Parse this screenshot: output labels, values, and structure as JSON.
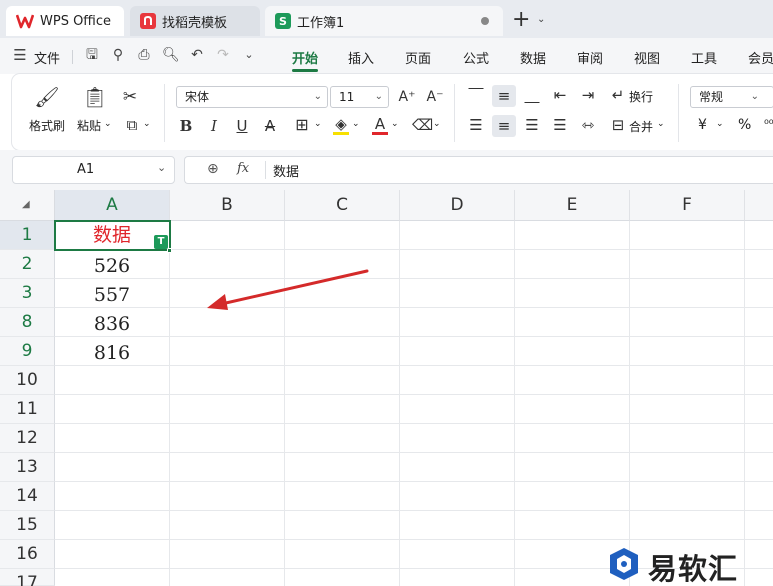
{
  "tabs": [
    {
      "label": "WPS Office",
      "icon": "wps-logo-icon"
    },
    {
      "label": "找稻壳模板",
      "icon": "docer-logo-icon"
    },
    {
      "label": "工作簿1",
      "icon": "spreadsheet-s-icon",
      "icon_letter": "S"
    }
  ],
  "menu": {
    "file": "文件",
    "items": [
      "开始",
      "插入",
      "页面",
      "公式",
      "数据",
      "审阅",
      "视图",
      "工具",
      "会员"
    ],
    "active": "开始"
  },
  "ribbon": {
    "format_painter": "格式刷",
    "paste": "粘贴",
    "font_name": "宋体",
    "font_size": "11",
    "wrap": "换行",
    "merge": "合并",
    "number_format": "常规",
    "currency": "¥",
    "percent": "%"
  },
  "formula_bar": {
    "name_box": "A1",
    "fx": "fx",
    "content": "数据"
  },
  "columns": [
    "A",
    "B",
    "C",
    "D",
    "E",
    "F"
  ],
  "rows": [
    "1",
    "2",
    "3",
    "8",
    "9",
    "10",
    "11",
    "12",
    "13",
    "14",
    "15",
    "16",
    "17"
  ],
  "cells": {
    "A1": "数据",
    "A2": "526",
    "A3": "557",
    "A8": "836",
    "A9": "816"
  },
  "filter_badge": "T",
  "colors": {
    "accent_green": "#1d7a44",
    "header_red": "#e0262b",
    "annotation_arrow": "#d42a2a"
  },
  "watermark": "易软汇"
}
